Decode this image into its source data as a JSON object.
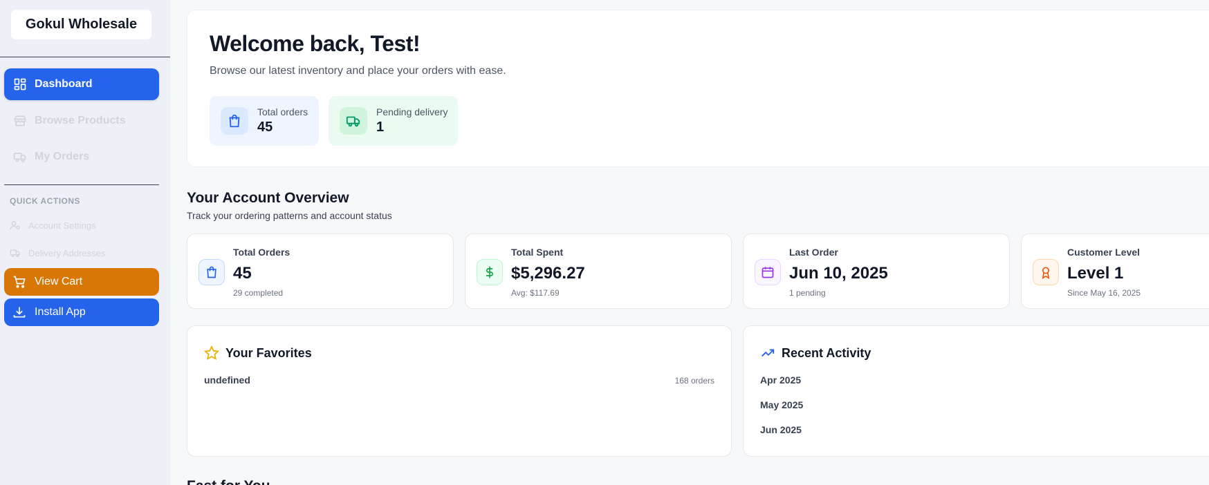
{
  "sidebar": {
    "brand": "Gokul Wholesale",
    "nav": [
      {
        "label": "Dashboard",
        "icon": "dashboard-icon"
      },
      {
        "label": "Browse Products",
        "icon": "store-icon"
      },
      {
        "label": "My Orders",
        "icon": "truck-icon"
      }
    ],
    "quick_actions_title": "QUICK ACTIONS",
    "quick_actions": [
      {
        "label": "Account Settings",
        "icon": "user-settings-icon"
      },
      {
        "label": "Delivery Addresses",
        "icon": "truck-icon"
      }
    ],
    "view_cart": "View Cart",
    "install_app": "Install App"
  },
  "welcome": {
    "title": "Welcome back, Test!",
    "subtitle": "Browse our latest inventory and place your orders with ease.",
    "total_orders_label": "Total orders",
    "total_orders_value": "45",
    "pending_label": "Pending delivery",
    "pending_value": "1"
  },
  "overview": {
    "title": "Your Account Overview",
    "subtitle": "Track your ordering patterns and account status",
    "cards": [
      {
        "label": "Total Orders",
        "value": "45",
        "note": "29 completed",
        "icon": "shopping-bag-icon"
      },
      {
        "label": "Total Spent",
        "value": "$5,296.27",
        "note": "Avg: $117.69",
        "icon": "dollar-icon"
      },
      {
        "label": "Last Order",
        "value": "Jun 10, 2025",
        "note": "1 pending",
        "icon": "calendar-icon"
      },
      {
        "label": "Customer Level",
        "value": "Level 1",
        "note": "Since May 16, 2025",
        "icon": "award-icon"
      }
    ]
  },
  "favorites": {
    "title": "Your Favorites",
    "item_name": "undefined",
    "item_count": "168 orders"
  },
  "activity": {
    "title": "Recent Activity",
    "months": [
      "Apr 2025",
      "May 2025",
      "Jun 2025"
    ]
  },
  "next_section_title": "Fast for You",
  "colors": {
    "primary": "#2563eb",
    "cart": "#d97706",
    "sidebar_bg": "#edf1f7"
  }
}
